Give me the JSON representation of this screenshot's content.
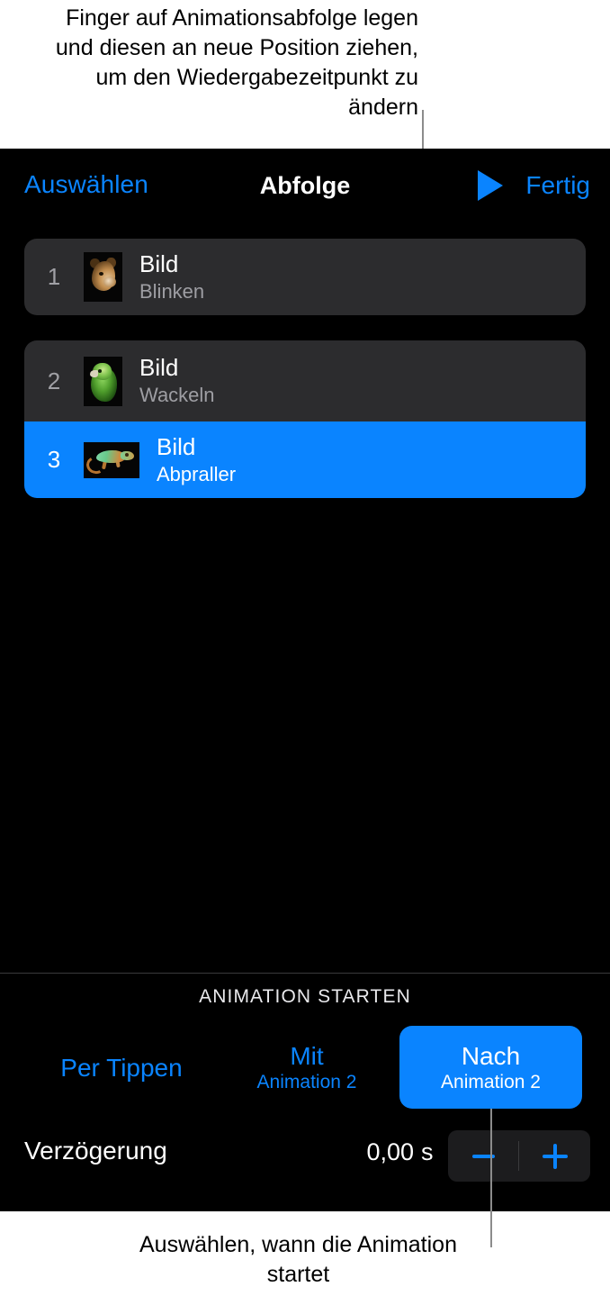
{
  "callouts": {
    "top": "Finger auf Animationsabfolge legen und diesen an neue Position ziehen, um den Wiedergabezeitpunkt zu ändern",
    "bottom": "Auswählen, wann die Animation startet"
  },
  "nav": {
    "select_label": "Auswählen",
    "title": "Abfolge",
    "done_label": "Fertig",
    "play_icon": "play-triangle-icon"
  },
  "sequence": {
    "rows": [
      {
        "index": "1",
        "title": "Bild",
        "effect": "Blinken",
        "thumbnail": "leopard-photo",
        "selected": false
      },
      {
        "index": "2",
        "title": "Bild",
        "effect": "Wackeln",
        "thumbnail": "parrot-photo",
        "selected": false
      },
      {
        "index": "3",
        "title": "Bild",
        "effect": "Abpraller",
        "thumbnail": "chameleon-photo",
        "selected": true
      }
    ]
  },
  "settings": {
    "section_header": "ANIMATION STARTEN",
    "start_options": [
      {
        "main": "Per Tippen",
        "sub": "",
        "selected": false
      },
      {
        "main": "Mit",
        "sub": "Animation 2",
        "selected": false
      },
      {
        "main": "Nach",
        "sub": "Animation 2",
        "selected": true
      }
    ],
    "delay": {
      "label": "Verzögerung",
      "value": "0,00",
      "unit": "s",
      "minus_icon": "minus-icon",
      "plus_icon": "plus-icon"
    }
  },
  "colors": {
    "accent": "#0a84ff",
    "panel_bg": "#000000",
    "row_bg": "#2c2c2e",
    "secondary_text": "#9e9ea3"
  }
}
